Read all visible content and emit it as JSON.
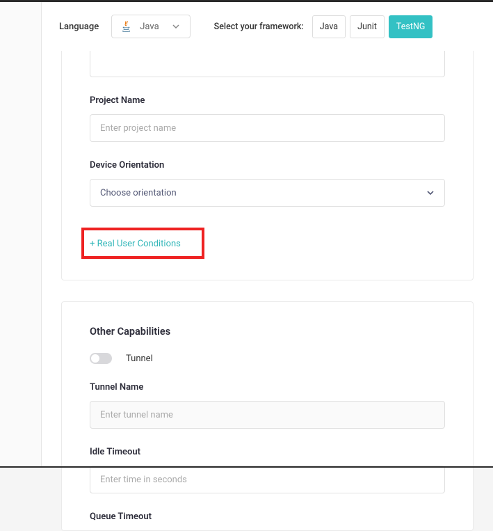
{
  "topbar": {
    "language_label": "Language",
    "language_selected": "Java",
    "framework_label": "Select your framework:",
    "frameworks": [
      "Java",
      "Junit",
      "TestNG"
    ],
    "active_framework_index": 2
  },
  "form": {
    "project_name_label": "Project Name",
    "project_name_placeholder": "Enter project name",
    "orientation_label": "Device Orientation",
    "orientation_placeholder": "Choose orientation",
    "expand_link": "+ Real User Conditions"
  },
  "other": {
    "section_title": "Other Capabilities",
    "tunnel_toggle_label": "Tunnel",
    "tunnel_name_label": "Tunnel Name",
    "tunnel_name_placeholder": "Enter tunnel name",
    "idle_timeout_label": "Idle Timeout",
    "idle_timeout_placeholder": "Enter time in seconds",
    "queue_timeout_label": "Queue Timeout"
  }
}
